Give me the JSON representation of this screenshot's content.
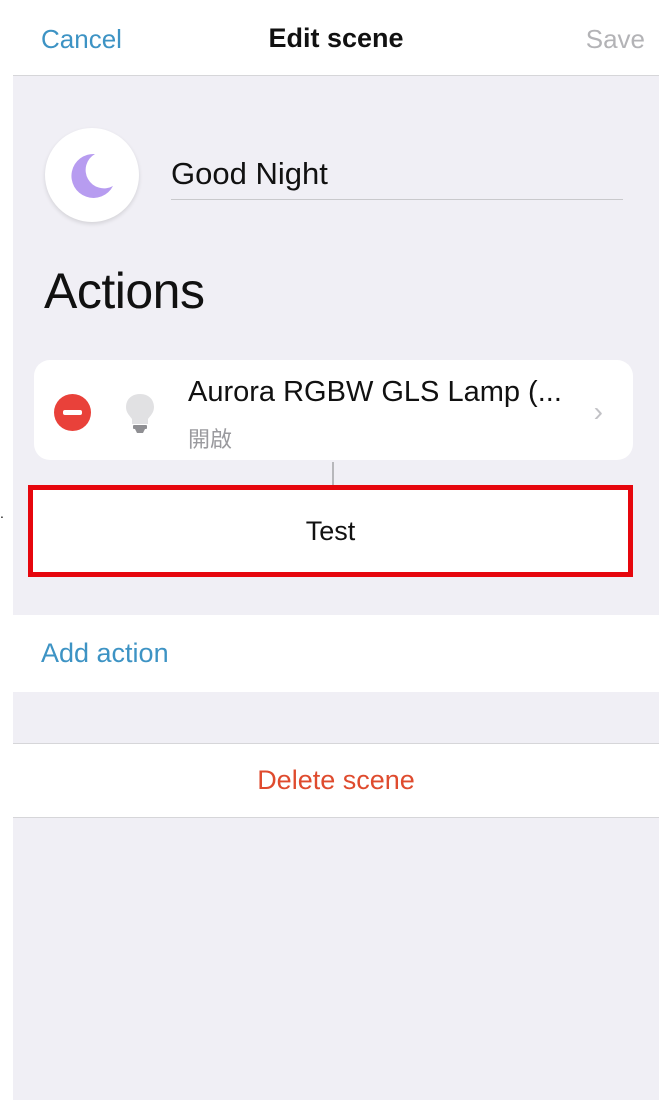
{
  "navbar": {
    "cancel_label": "Cancel",
    "title": "Edit scene",
    "save_label": "Save"
  },
  "scene": {
    "icon": "moon-icon",
    "name": "Good Night"
  },
  "actions": {
    "heading": "Actions",
    "items": [
      {
        "title": "Aurora RGBW GLS Lamp (...",
        "state": "開啟",
        "icon": "bulb-icon"
      }
    ],
    "test_label": "Test",
    "add_action_label": "Add action"
  },
  "delete_label": "Delete scene",
  "colors": {
    "accent": "#3d93c4",
    "destructive": "#df4b2e",
    "remove": "#e9413a",
    "highlight_border": "#e6060d",
    "background": "#f0eff5",
    "moon": "#b79cf0"
  }
}
